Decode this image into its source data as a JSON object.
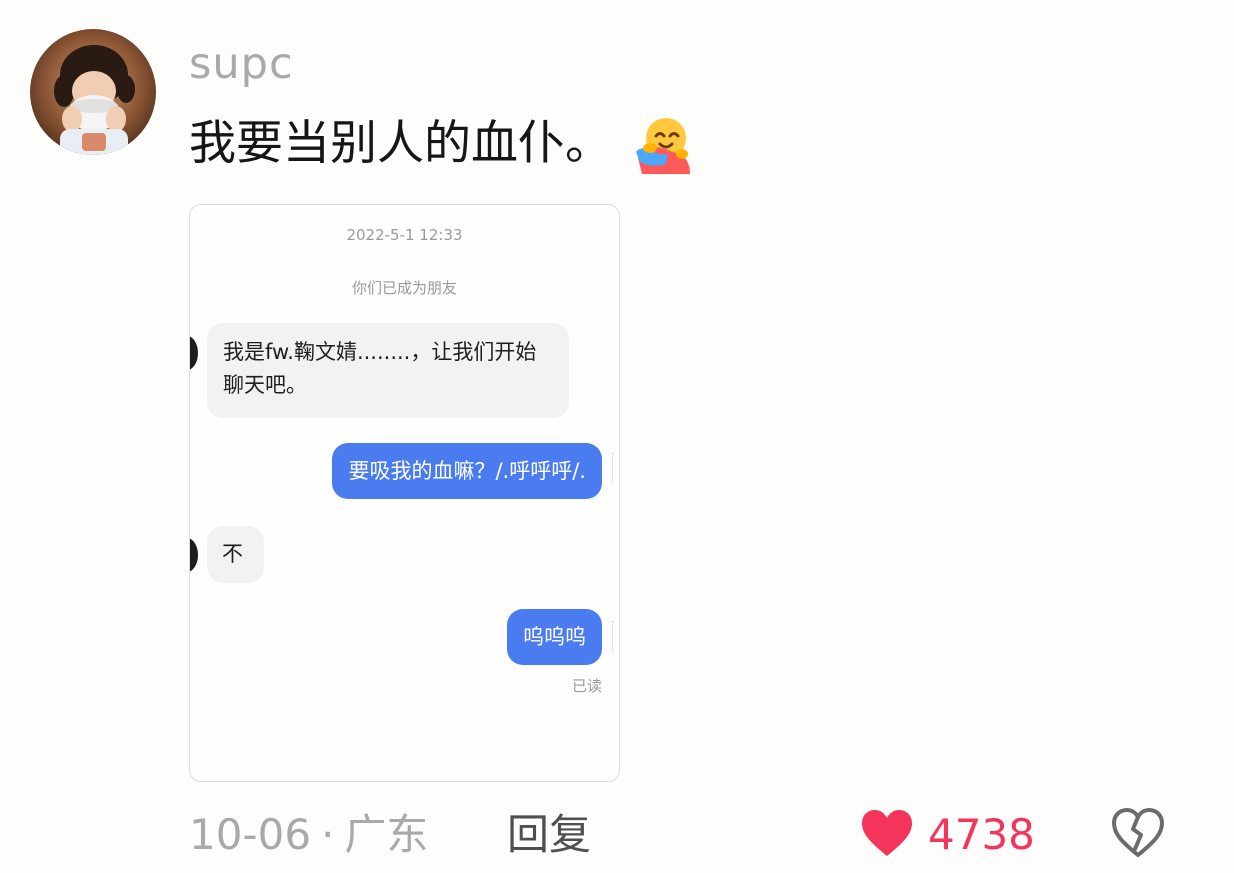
{
  "comment": {
    "username": "supc",
    "text": "我要当别人的血仆。",
    "emoji_icon": "hugging-face-icon",
    "date": "10-06",
    "separator": "·",
    "location": "广东",
    "reply_label": "回复",
    "like_count": "4738",
    "colors": {
      "like": "#f4345a",
      "username": "#a9a9a9"
    }
  },
  "chat": {
    "timestamp": "2022-5-1 12:33",
    "system_notice": "你们已成为朋友",
    "messages": [
      {
        "side": "left",
        "text": "我是fw.鞠文婧........，让我们开始聊天吧。"
      },
      {
        "side": "right",
        "text": "要吸我的血嘛？/.呼呼呼/."
      },
      {
        "side": "left",
        "text": "不"
      },
      {
        "side": "right",
        "text": "呜呜呜"
      }
    ],
    "read_status": "已读",
    "colors": {
      "outgoing_bubble": "#4a7cef",
      "incoming_bubble": "#f2f2f2"
    }
  }
}
